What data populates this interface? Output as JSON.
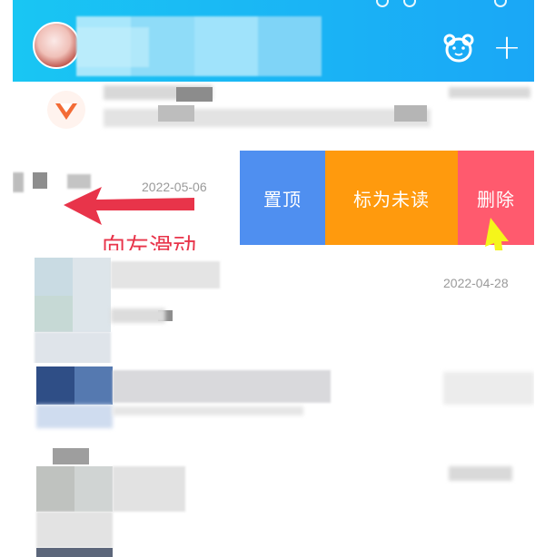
{
  "header": {
    "bear_icon": "bear-face-icon",
    "add_icon_glyph": "+"
  },
  "list": {
    "item_dates": {
      "swiped_item": "2022-05-06",
      "item_3": "2022-04-28"
    }
  },
  "swipe_actions": {
    "pin_label": "置顶",
    "mark_unread_label": "标为未读",
    "delete_label": "删除",
    "colors": {
      "pin": "#4f8ff0",
      "mark_unread": "#ff9a0d",
      "delete": "#ff5a6e"
    }
  },
  "annotation": {
    "swipe_instruction": "向左滑动",
    "arrow_color_left": "#e8344a",
    "arrow_color_pointer": "#f5f51a"
  }
}
